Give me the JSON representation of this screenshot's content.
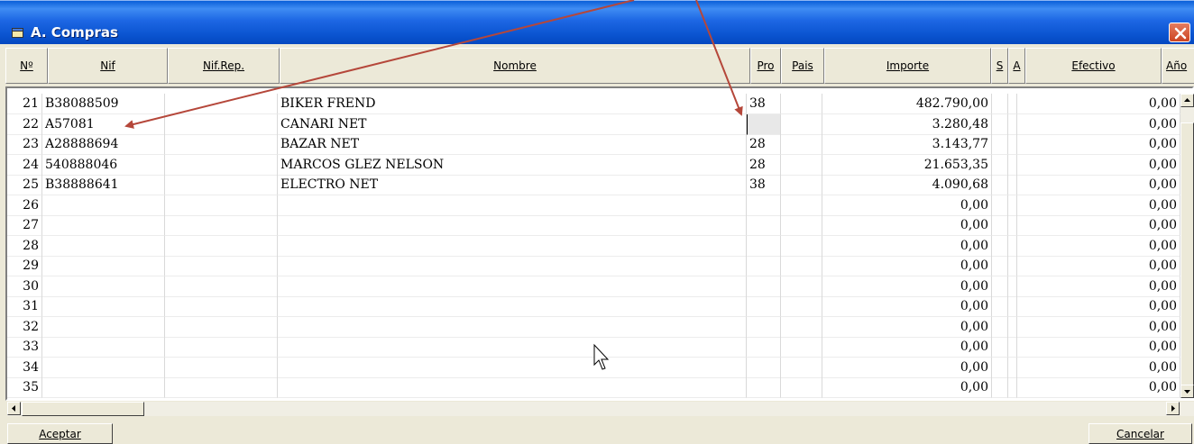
{
  "window": {
    "title": "A.  Compras"
  },
  "columns": [
    "Nº",
    "Nif",
    "Nif.Rep.",
    "Nombre",
    "Pro",
    "Pais",
    "Importe",
    "S",
    "A",
    "Efectivo",
    "Año"
  ],
  "rows": [
    {
      "n": "21",
      "nif": "B38088509",
      "nombre": "BIKER FREND",
      "pro": "38",
      "importe": "482.790,00",
      "efectivo": "0,00"
    },
    {
      "n": "22",
      "nif": "A57081",
      "nombre": "CANARI NET",
      "pro": "",
      "importe": "3.280,48",
      "efectivo": "0,00"
    },
    {
      "n": "23",
      "nif": "A28888694",
      "nombre": "BAZAR NET",
      "pro": "28",
      "importe": "3.143,77",
      "efectivo": "0,00"
    },
    {
      "n": "24",
      "nif": "540888046",
      "nombre": "MARCOS GLEZ NELSON",
      "pro": "28",
      "importe": "21.653,35",
      "efectivo": "0,00"
    },
    {
      "n": "25",
      "nif": "B38888641",
      "nombre": "ELECTRO NET",
      "pro": "38",
      "importe": "4.090,68",
      "efectivo": "0,00"
    },
    {
      "n": "26",
      "nif": "",
      "nombre": "",
      "pro": "",
      "importe": "0,00",
      "efectivo": "0,00"
    },
    {
      "n": "27",
      "nif": "",
      "nombre": "",
      "pro": "",
      "importe": "0,00",
      "efectivo": "0,00"
    },
    {
      "n": "28",
      "nif": "",
      "nombre": "",
      "pro": "",
      "importe": "0,00",
      "efectivo": "0,00"
    },
    {
      "n": "29",
      "nif": "",
      "nombre": "",
      "pro": "",
      "importe": "0,00",
      "efectivo": "0,00"
    },
    {
      "n": "30",
      "nif": "",
      "nombre": "",
      "pro": "",
      "importe": "0,00",
      "efectivo": "0,00"
    },
    {
      "n": "31",
      "nif": "",
      "nombre": "",
      "pro": "",
      "importe": "0,00",
      "efectivo": "0,00"
    },
    {
      "n": "32",
      "nif": "",
      "nombre": "",
      "pro": "",
      "importe": "0,00",
      "efectivo": "0,00"
    },
    {
      "n": "33",
      "nif": "",
      "nombre": "",
      "pro": "",
      "importe": "0,00",
      "efectivo": "0,00"
    },
    {
      "n": "34",
      "nif": "",
      "nombre": "",
      "pro": "",
      "importe": "0,00",
      "efectivo": "0,00"
    },
    {
      "n": "35",
      "nif": "",
      "nombre": "",
      "pro": "",
      "importe": "0,00",
      "efectivo": "0,00"
    }
  ],
  "buttons": {
    "accept": "Aceptar",
    "cancel": "Cancelar"
  },
  "icons": {
    "title": "window-icon",
    "close": "close-icon",
    "cursor": "mouse-pointer-icon"
  },
  "colors": {
    "titlebar": "#0a53cf",
    "close": "#cc4422",
    "annotation": "#b5473a"
  }
}
